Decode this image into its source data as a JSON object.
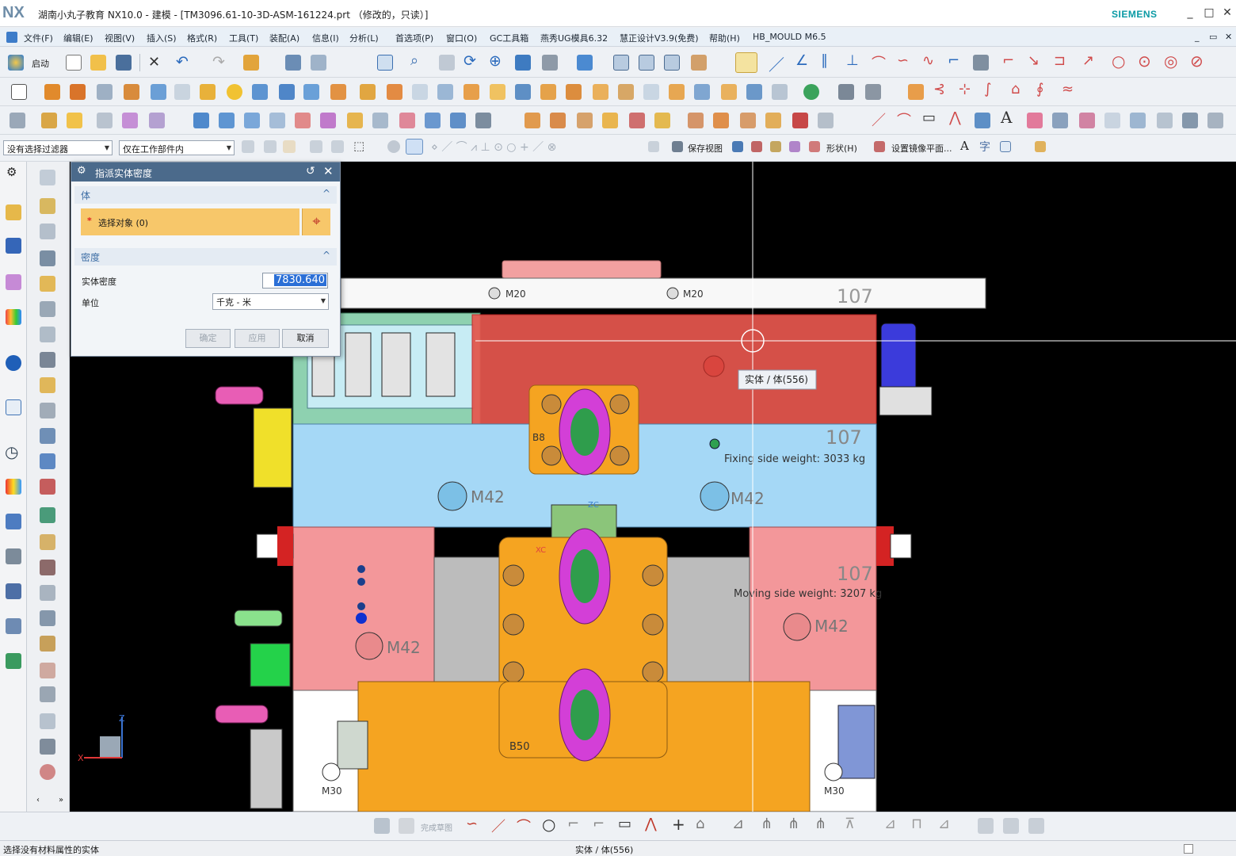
{
  "window": {
    "logo": "NX",
    "title": "湖南小丸子教育 NX10.0 - 建模 - [TM3096.61-10-3D-ASM-161224.prt （修改的，只读）]",
    "brand": "SIEMENS",
    "controls": [
      "_",
      "□",
      "✕"
    ]
  },
  "menubar": {
    "items": [
      "文件(F)",
      "编辑(E)",
      "视图(V)",
      "插入(S)",
      "格式(R)",
      "工具(T)",
      "装配(A)",
      "信息(I)",
      "分析(L)",
      "首选项(P)",
      "窗口(O)",
      "GC工具箱",
      "燕秀UG模具6.32",
      "慧正设计V3.9(免费)",
      "帮助(H)",
      "HB_MOULD M6.5"
    ],
    "doc_controls": [
      "_",
      "▭",
      "✕"
    ]
  },
  "toolbar1": {
    "start_label": "启动"
  },
  "selection_bar": {
    "filter": "没有选择过滤器",
    "scope": "仅在工作部件内",
    "save_view": "保存视图",
    "shape": "形状(H)",
    "mirror": "设置镜像平面..."
  },
  "dialog": {
    "title": "指派实体密度",
    "body_section": "体",
    "select_label": "选择对象 (0)",
    "required_mark": "*",
    "density_section": "密度",
    "density_label": "实体密度",
    "density_value": "7830.640",
    "unit_label": "单位",
    "unit_value": "千克 - 米",
    "ok": "确定",
    "apply": "应用",
    "cancel": "取消"
  },
  "model": {
    "top_plate_number": "107",
    "m20_a": "M20",
    "m20_b": "M20",
    "fixing_number": "107",
    "fixing_weight": "Fixing side weight: 3033 kg",
    "m42_1": "M42",
    "m42_2": "M42",
    "m42_3": "M42",
    "m42_4": "M42",
    "moving_number": "107",
    "moving_weight": "Moving side weight: 3207 kg",
    "b8": "B8",
    "b50": "B50",
    "m30_a": "M30",
    "m30_b": "M30",
    "zc": "ZC",
    "xc": "XC",
    "tooltip": "实体 / 体(556)",
    "triad_z": "Z",
    "triad_x": "X"
  },
  "bottom_toolbar": {
    "finish_sketch": "完成草图"
  },
  "status": {
    "left": "选择没有材料属性的实体",
    "center": "实体 / 体(556)"
  }
}
